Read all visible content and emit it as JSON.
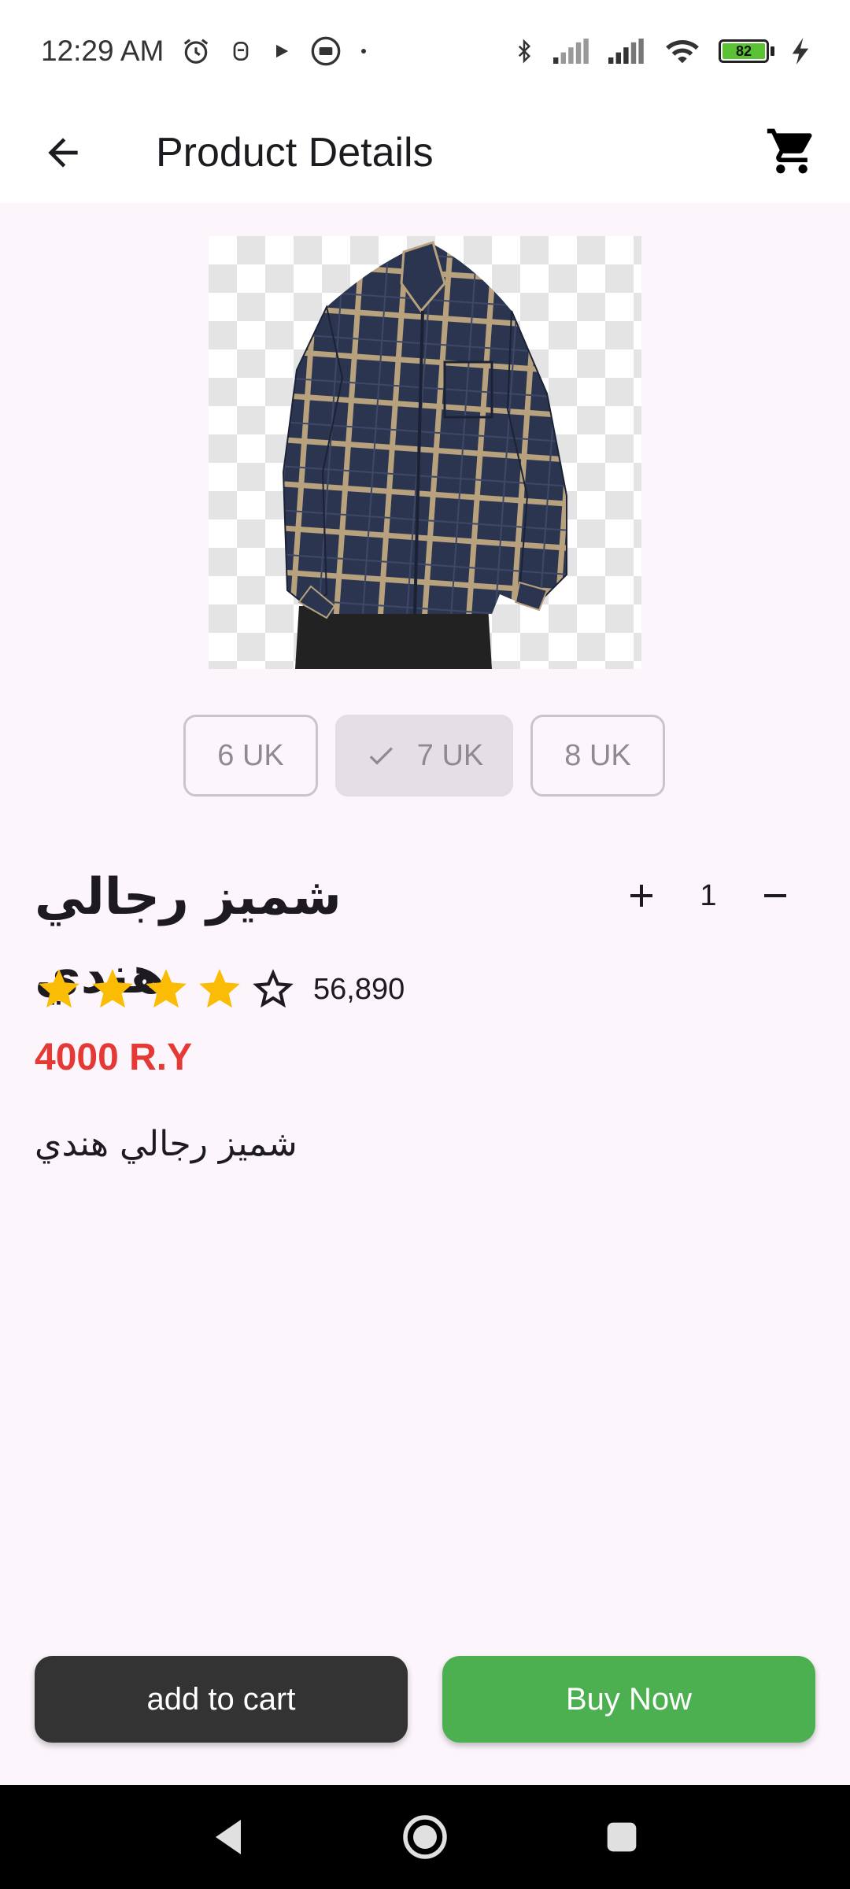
{
  "status_bar": {
    "time": "12:29 AM",
    "battery_level": "82",
    "icons": [
      "alarm-icon",
      "notification-icon",
      "play-icon",
      "media-icon",
      "dot-icon",
      "bluetooth-icon",
      "signal-icon",
      "signal-icon-2",
      "wifi-icon",
      "battery-icon",
      "charging-icon"
    ]
  },
  "app_bar": {
    "title": "Product Details",
    "back_icon": "arrow-back-icon",
    "cart_icon": "shopping-cart-icon"
  },
  "product": {
    "image_icon": "plaid-shirt-image",
    "title": "شميز رجالي هندي",
    "rating": 4,
    "rating_max": 5,
    "rating_count": "56,890",
    "price": "4000 R.Y",
    "description": "شميز رجالي هندي"
  },
  "sizes": [
    {
      "label": "6 UK",
      "selected": false
    },
    {
      "label": "7 UK",
      "selected": true
    },
    {
      "label": "8 UK",
      "selected": false
    }
  ],
  "quantity": {
    "value": "1",
    "increase_icon": "plus-icon",
    "decrease_icon": "minus-icon"
  },
  "actions": {
    "add_to_cart": "add to cart",
    "buy_now": "Buy Now"
  },
  "colors": {
    "price": "#e53935",
    "buy_now": "#4caf50",
    "add_to_cart": "#333333",
    "star": "#fbbc05",
    "background": "#fcf6fc"
  },
  "nav_bar": {
    "icons": [
      "nav-back-icon",
      "nav-home-icon",
      "nav-recents-icon"
    ]
  }
}
